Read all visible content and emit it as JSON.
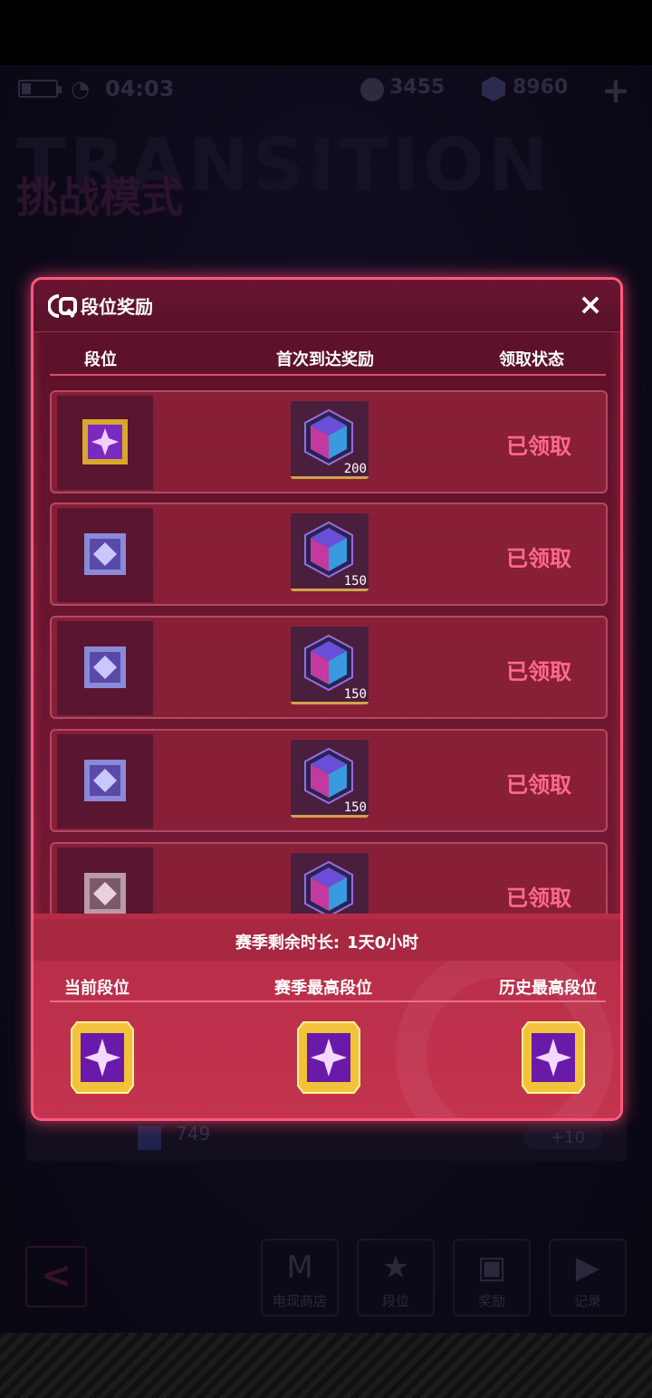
{
  "status_bar": {
    "time": "04:03",
    "coins": "3455",
    "gems": "8960",
    "plus": "+",
    "wifi": "◔"
  },
  "background": {
    "title": "TRANSITION",
    "subtitle": "挑战模式",
    "panel_value": "749",
    "panel_bonus": "+10"
  },
  "nav": {
    "back": "<",
    "items": [
      {
        "label": "电现商店",
        "icon": "M"
      },
      {
        "label": "段位",
        "icon": "★"
      },
      {
        "label": "奖励",
        "icon": "▣"
      },
      {
        "label": "记录",
        "icon": "▶"
      }
    ]
  },
  "modal": {
    "title": "段位奖励",
    "close": "×",
    "headers": {
      "rank": "段位",
      "reward": "首次到达奖励",
      "status": "领取状态"
    },
    "rows": [
      {
        "badge": "purple-gold",
        "reward": "200",
        "status": "已领取"
      },
      {
        "badge": "silver-blue",
        "reward": "150",
        "status": "已领取"
      },
      {
        "badge": "silver-blue",
        "reward": "150",
        "status": "已领取"
      },
      {
        "badge": "silver-blue",
        "reward": "150",
        "status": "已领取"
      },
      {
        "badge": "silver-pink",
        "reward": "",
        "status": "已领取"
      }
    ],
    "season": {
      "label": "赛季剩余时长:",
      "value": "1天0小时"
    },
    "stats": {
      "current": "当前段位",
      "season_best": "赛季最高段位",
      "history_best": "历史最高段位"
    }
  },
  "colors": {
    "modal_border": "#ff5a7e",
    "status_claimed": "#ff6a88",
    "reward_underline": "#d2a24a"
  }
}
